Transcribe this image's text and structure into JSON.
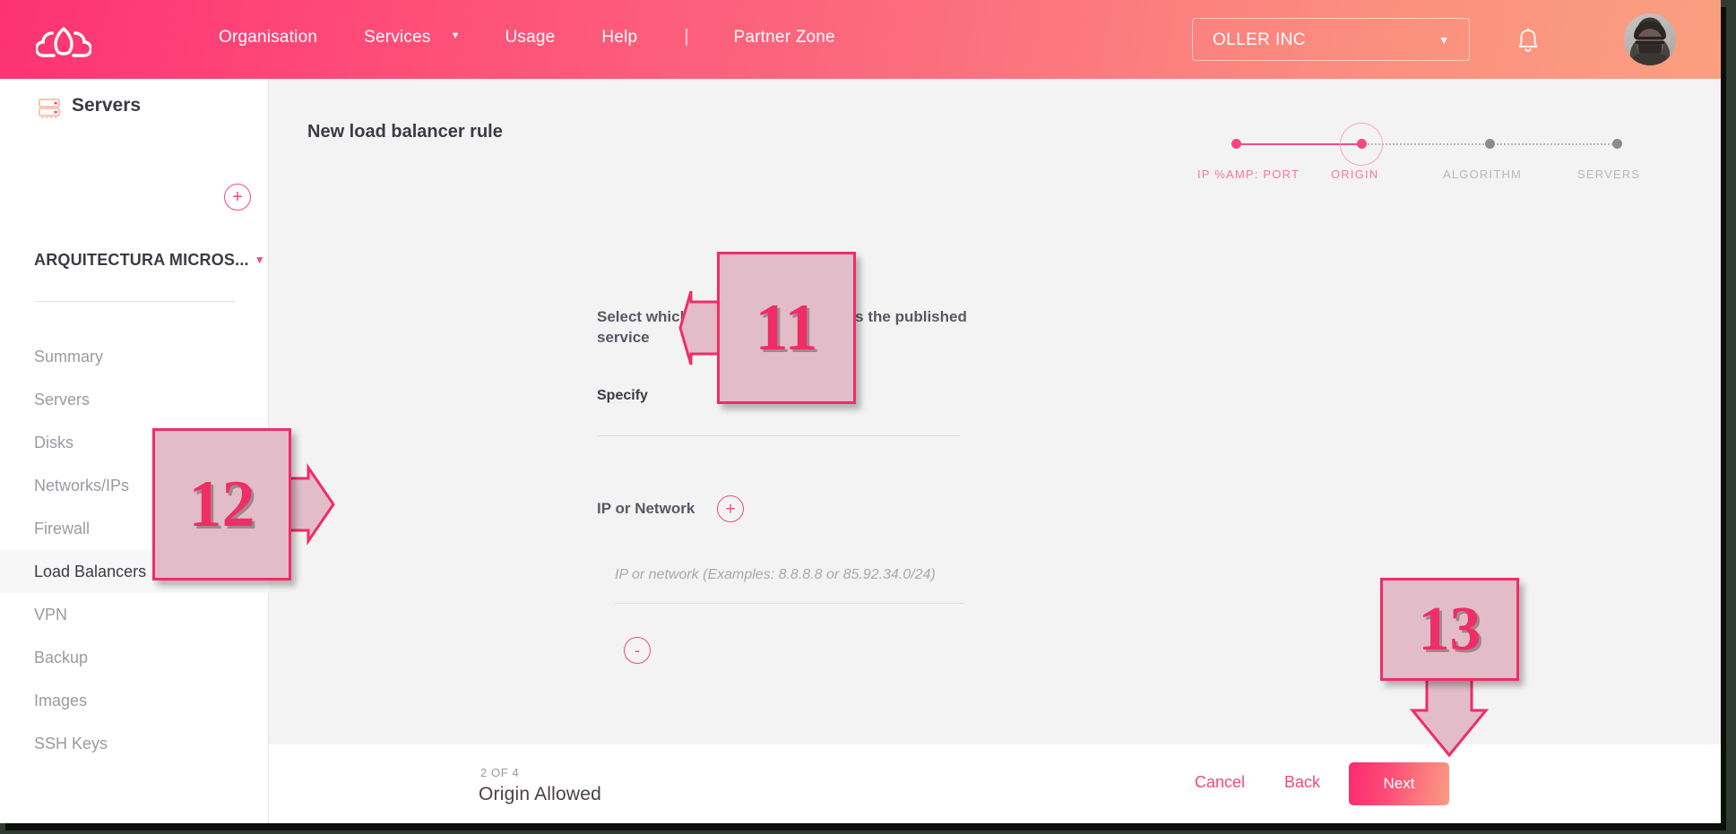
{
  "header": {
    "logo_icon": "cloud-logo-icon",
    "nav": [
      {
        "label": "Organisation",
        "caret": false
      },
      {
        "label": "Services",
        "caret": true
      },
      {
        "label": "Usage",
        "caret": false
      },
      {
        "label": "Help",
        "caret": false
      },
      {
        "label": "Partner Zone",
        "caret": false
      }
    ],
    "separator": "|",
    "org_selector": {
      "value": "OLLER INC",
      "caret": "▼"
    },
    "bell_icon": "notification-bell-icon",
    "avatar_icon": "user-avatar"
  },
  "sidebar": {
    "section_icon": "server-rack-icon",
    "section_title": "Servers",
    "add_button_label": "+",
    "project": "ARQUITECTURA MICROS...",
    "project_caret": "▼",
    "items": [
      {
        "label": "Summary",
        "active": false
      },
      {
        "label": "Servers",
        "active": false
      },
      {
        "label": "Disks",
        "active": false
      },
      {
        "label": "Networks/IPs",
        "active": false
      },
      {
        "label": "Firewall",
        "active": false
      },
      {
        "label": "Load Balancers",
        "active": true
      },
      {
        "label": "VPN",
        "active": false
      },
      {
        "label": "Backup",
        "active": false
      },
      {
        "label": "Images",
        "active": false
      },
      {
        "label": "SSH Keys",
        "active": false
      }
    ]
  },
  "main": {
    "page_title": "New load balancer rule",
    "stepper": {
      "steps": [
        {
          "label": "IP %AMP: PORT",
          "state": "done"
        },
        {
          "label": "ORIGIN",
          "state": "current"
        },
        {
          "label": "ALGORITHM",
          "state": "todo"
        },
        {
          "label": "SERVERS",
          "state": "todo"
        }
      ]
    },
    "question": "Select which IPs you allow to access the published service",
    "specify_field": {
      "value": "Specify"
    },
    "ip_section": {
      "label": "IP or Network",
      "add_label": "+",
      "remove_label": "-",
      "input_value": "",
      "input_placeholder": "IP or network (Examples: 8.8.8.8 or 85.92.34.0/24)"
    }
  },
  "footer": {
    "step_count": "2 OF 4",
    "step_name": "Origin Allowed",
    "cancel_label": "Cancel",
    "back_label": "Back",
    "next_label": "Next"
  },
  "annotations": [
    {
      "id": "11",
      "number": "11",
      "direction": "left"
    },
    {
      "id": "12",
      "number": "12",
      "direction": "right"
    },
    {
      "id": "13",
      "number": "13",
      "direction": "down"
    }
  ],
  "colors": {
    "brand_pink": "#f5487f",
    "brand_pink_deep": "#fd2a6f",
    "brand_peach": "#fa9f80",
    "annotation_fill": "#e2bcc9",
    "annotation_stroke": "#ef2d68",
    "muted_text": "#9a9aa2",
    "dark_text": "#3a3b45"
  }
}
